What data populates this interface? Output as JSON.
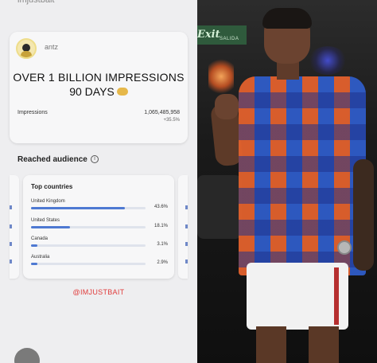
{
  "header": {
    "handle": "imjustbait"
  },
  "card": {
    "username": "antz",
    "headline_line1": "OVER 1 BILLION IMPRESSIONS",
    "headline_line2": "90 DAYS",
    "emoji_icon": "handshake-icon",
    "impressions_label": "Impressions",
    "impressions_value": "1,065,485,958",
    "impressions_change": "+35.5%"
  },
  "audience": {
    "title": "Reached audience",
    "info_icon": "info-icon",
    "top_countries_title": "Top countries",
    "countries": [
      {
        "name": "United Kingdom",
        "pct": "43.6%",
        "value": 43.6
      },
      {
        "name": "United States",
        "pct": "18.1%",
        "value": 18.1
      },
      {
        "name": "Canada",
        "pct": "3.1%",
        "value": 3.1
      },
      {
        "name": "Australia",
        "pct": "2.9%",
        "value": 2.9
      }
    ]
  },
  "caption": "@IMJUSTBAIT",
  "photo": {
    "sign_text": "Exit",
    "sign_small": "SALIDA"
  },
  "colors": {
    "accent_blue": "#4e79d2",
    "caption_red": "#e03c3c",
    "shirt_orange": "#e2612d",
    "shirt_blue": "#2f5cc8"
  }
}
